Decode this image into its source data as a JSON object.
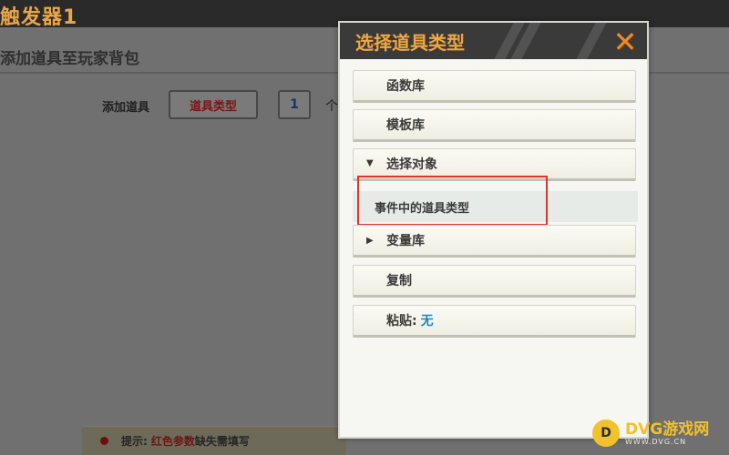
{
  "window": {
    "title": "触发器1"
  },
  "editor": {
    "section_title": "添加道具至玩家背包",
    "row_label": "添加道具",
    "param_button": "道具类型",
    "quantity": "1",
    "unit": "个"
  },
  "hint": {
    "prefix": "提示:",
    "red_text": "红色参数",
    "suffix": "缺失需填写"
  },
  "popup": {
    "title": "选择道具类型",
    "close_icon": "close-x-icon",
    "items": [
      {
        "label": "函数库"
      },
      {
        "label": "模板库"
      },
      {
        "label": "选择对象",
        "expanded": true
      },
      {
        "label": "事件中的道具类型",
        "sub": true,
        "selected": true
      },
      {
        "label": "变量库",
        "expanded": false
      },
      {
        "label": "复制"
      },
      {
        "label": "粘贴:",
        "value": "无"
      }
    ]
  },
  "watermark": {
    "logo": "D",
    "name": "DVG游戏网",
    "url": "WWW.DVG.CN"
  },
  "colors": {
    "accent": "#f1a640",
    "highlight": "#e0332f",
    "link": "#1a86d0"
  }
}
